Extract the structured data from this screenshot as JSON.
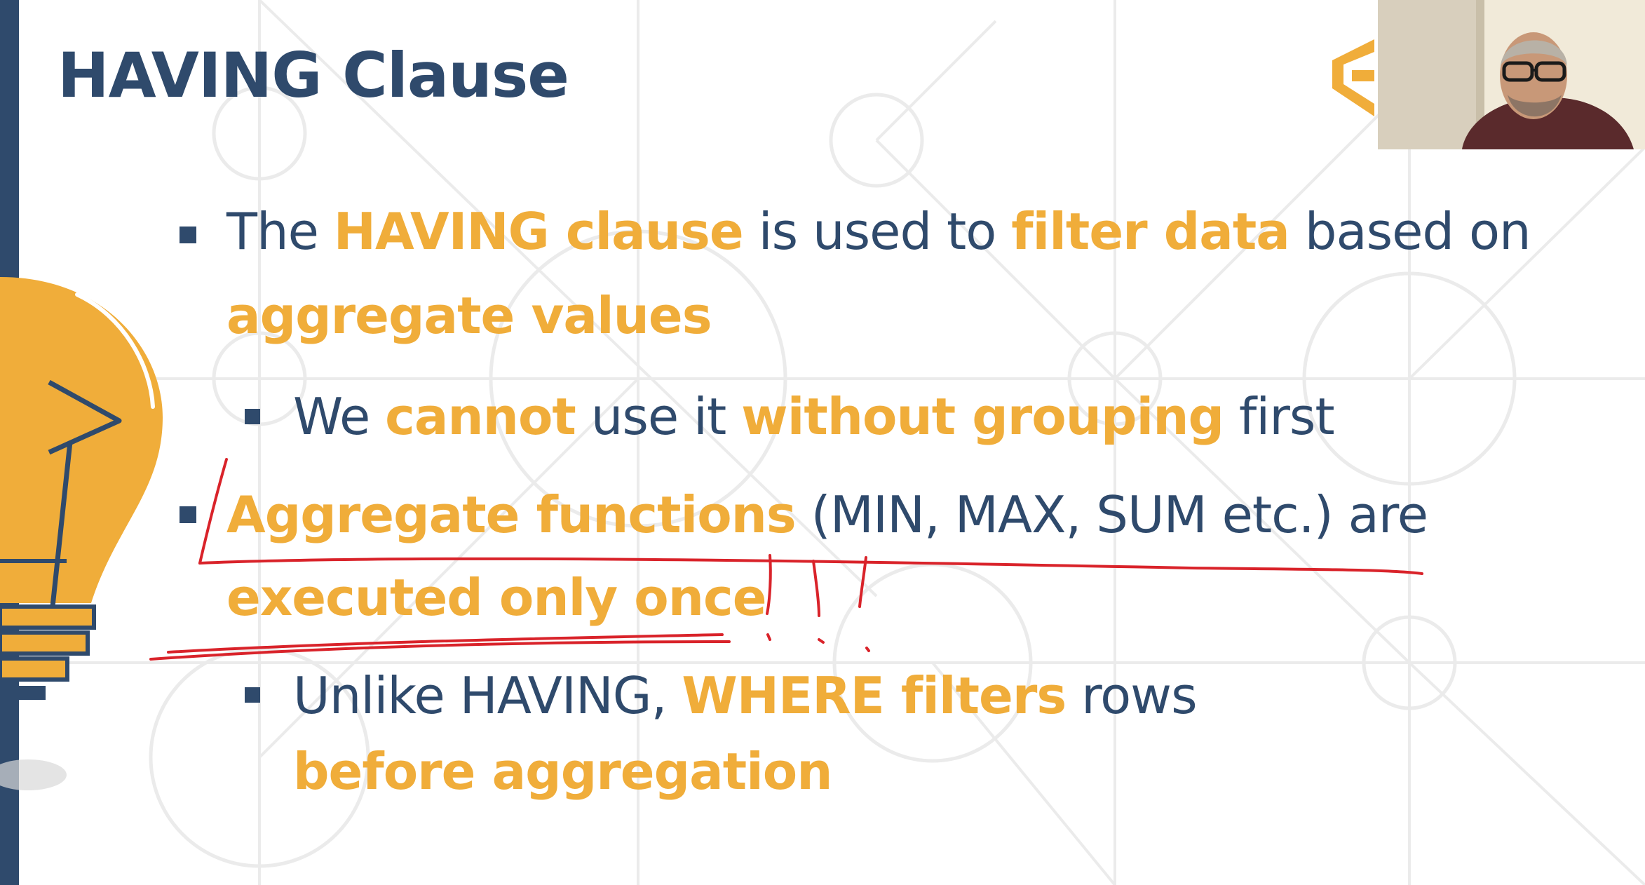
{
  "slide": {
    "title": "HAVING Clause",
    "bullets": [
      {
        "level": 1,
        "line1": {
          "t1": "The ",
          "e1": "HAVING clause",
          "t2": " is used to ",
          "e2": "filter data",
          "t3": " based on"
        },
        "line2": {
          "e1": "aggregate values"
        }
      },
      {
        "level": 2,
        "line1": {
          "t1": "We ",
          "e1": "cannot",
          "t2": " use it ",
          "e2": "without grouping",
          "t3": " first"
        }
      },
      {
        "level": 1,
        "line1": {
          "e1": "Aggregate functions",
          "t1": " (MIN, MAX, SUM etc.) are"
        },
        "line2": {
          "e1": "executed only once"
        }
      },
      {
        "level": 2,
        "line1": {
          "t1": "Unlike HAVING, ",
          "e1": "WHERE filters",
          "t2": " rows"
        },
        "line2": {
          "e1": "before aggregation"
        }
      }
    ]
  },
  "colors": {
    "navy": "#2f4a6c",
    "accent": "#f0ad3a",
    "annotation": "#d9232a"
  },
  "icons": {
    "bulb": "lightbulb-illustration",
    "logo": "brand-logo-icon"
  }
}
